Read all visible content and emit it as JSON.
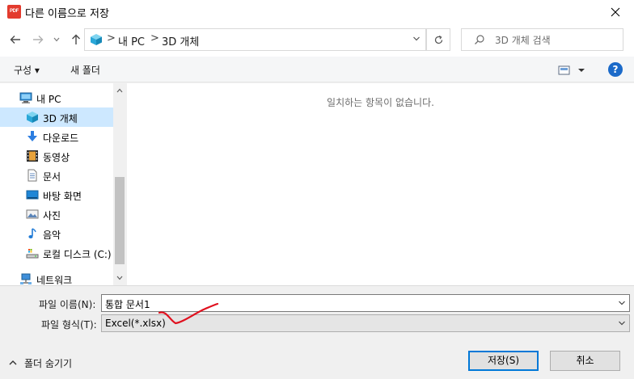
{
  "window": {
    "app_icon_text": "PDF",
    "title": "다른 이름으로 저장",
    "close_glyph": "✕"
  },
  "nav": {
    "back_glyph": "←",
    "forward_glyph": "→",
    "recent_glyph": "˅",
    "up_glyph": "↑",
    "breadcrumb": [
      "내 PC",
      "3D 개체"
    ],
    "separator": ">",
    "refresh_glyph": "↻"
  },
  "search": {
    "placeholder": "3D 개체 검색"
  },
  "toolbar": {
    "organize_label": "구성 ▾",
    "new_folder_label": "새 폴더",
    "help_glyph": "?"
  },
  "sidebar": {
    "items": [
      {
        "label": "내 PC",
        "icon": "pc-icon",
        "selected": false
      },
      {
        "label": "3D 개체",
        "icon": "3d-objects-icon",
        "selected": true
      },
      {
        "label": "다운로드",
        "icon": "download-icon",
        "selected": false
      },
      {
        "label": "동영상",
        "icon": "video-icon",
        "selected": false
      },
      {
        "label": "문서",
        "icon": "document-icon",
        "selected": false
      },
      {
        "label": "바탕 화면",
        "icon": "desktop-icon",
        "selected": false
      },
      {
        "label": "사진",
        "icon": "pictures-icon",
        "selected": false
      },
      {
        "label": "음악",
        "icon": "music-icon",
        "selected": false
      },
      {
        "label": "로컬 디스크 (C:)",
        "icon": "drive-icon",
        "selected": false
      },
      {
        "label": "네트워크",
        "icon": "network-icon",
        "selected": false
      }
    ]
  },
  "content": {
    "empty_message": "일치하는 항목이 없습니다."
  },
  "form": {
    "filename_label": "파일 이름(N):",
    "filename_value": "통합 문서1",
    "filetype_label": "파일 형식(T):",
    "filetype_value": "Excel(*.xlsx)"
  },
  "footer": {
    "hide_folders_label": "폴더 숨기기",
    "save_label": "저장(S)",
    "cancel_label": "취소"
  },
  "colors": {
    "accent": "#0078d7",
    "selected_bg": "#cde8ff",
    "annotation": "#e0101e"
  }
}
